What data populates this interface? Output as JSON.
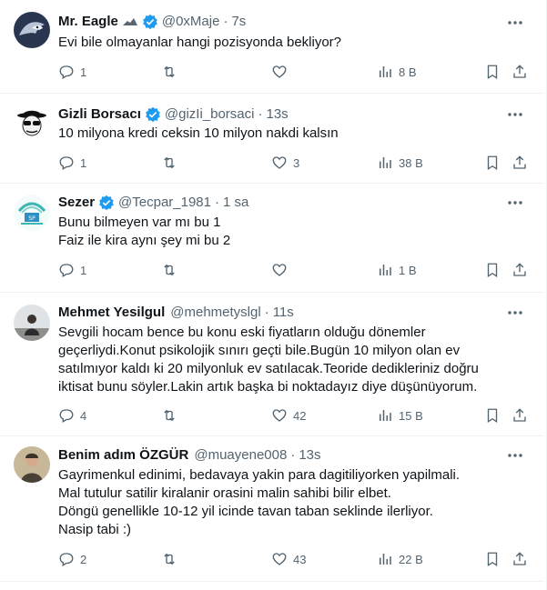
{
  "tweets": [
    {
      "name": "Mr. Eagle",
      "handle": "@0xMaje",
      "time": "7s",
      "lines": [
        "Evi bile olmayanlar hangi pozisyonda bekliyor?"
      ],
      "replies": "1",
      "retweets": "",
      "likes": "",
      "views": "8 B",
      "avatar_icon": "eagle-avatar",
      "accent": "#1d9bf0"
    },
    {
      "name": "Gizli Borsacı",
      "handle": "@gizIi_borsaci",
      "time": "13s",
      "lines": [
        "10 milyona kredi ceksin 10 milyon nakdi kalsın"
      ],
      "replies": "1",
      "retweets": "",
      "likes": "3",
      "views": "38 B",
      "avatar_icon": "masked-face-avatar"
    },
    {
      "name": "Sezer",
      "handle": "@Tecpar_1981",
      "time": "1 sa",
      "lines": [
        "Bunu bilmeyen var mı bu 1",
        "Faiz ile kira aynı şey mi bu 2"
      ],
      "replies": "1",
      "retweets": "",
      "likes": "",
      "views": "1 B",
      "avatar_icon": "logo-avatar"
    },
    {
      "name": "Mehmet Yesilgul",
      "handle": "@mehmetyslgl",
      "time": "11s",
      "lines": [
        "Sevgili hocam bence bu konu eski fiyatların olduğu dönemler",
        "geçerliydi.Konut psikolojik sınırı geçti bile.Bugün 10 milyon olan ev",
        "satılmıyor kaldı ki 20 milyonluk ev satılacak.Teoride dedikleriniz doğru",
        "iktisat bunu söyler.Lakin artık başka bi noktadayız diye düşünüyorum."
      ],
      "replies": "4",
      "retweets": "",
      "likes": "42",
      "views": "15 B",
      "avatar_icon": "photo-avatar"
    },
    {
      "name": "Benim adım ÖZGÜR",
      "handle": "@muayene008",
      "time": "13s",
      "lines": [
        "Gayrimenkul edinimi, bedavaya yakin para dagitiliyorken yapilmali.",
        "Mal tutulur satilir kiralanir orasini malin sahibi bilir elbet.",
        "Döngü genellikle 10-12 yil icinde tavan taban seklinde ilerliyor.",
        "Nasip tabi :)"
      ],
      "replies": "2",
      "retweets": "",
      "likes": "43",
      "views": "22 B",
      "avatar_icon": "person-avatar"
    }
  ]
}
